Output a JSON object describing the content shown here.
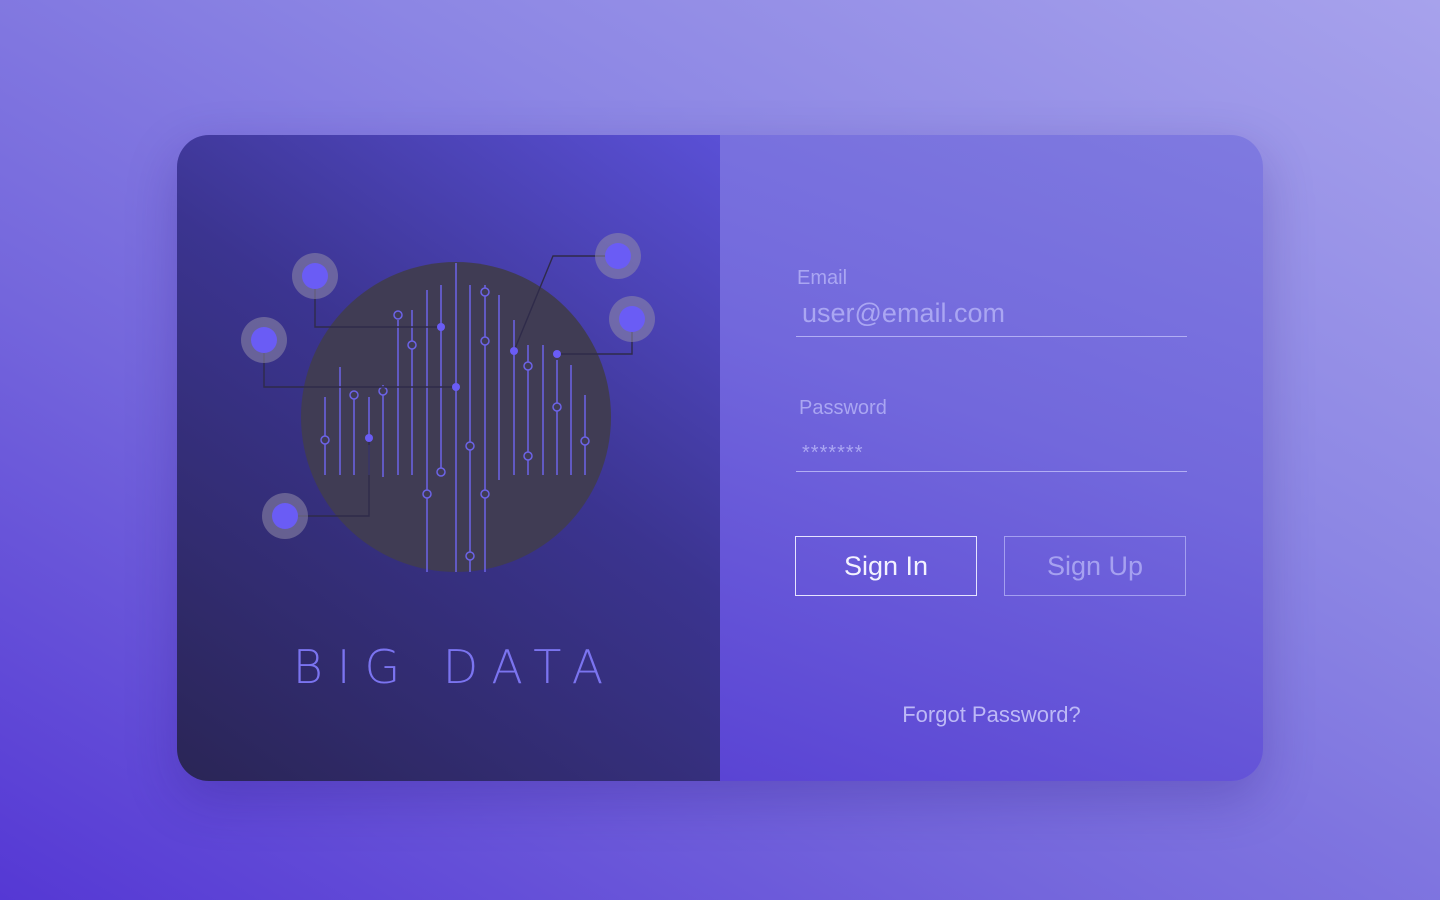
{
  "branding": {
    "title": "BIG DATA",
    "illustration_icon": "circuit-brain-icon"
  },
  "form": {
    "email_label": "Email",
    "email_placeholder": "user@email.com",
    "email_value": "",
    "password_label": "Password",
    "password_value": "*******",
    "signin_label": "Sign In",
    "signup_label": "Sign Up",
    "forgot_label": "Forgot Password?"
  },
  "colors": {
    "accent": "#6b5cff",
    "circle": "#3f3c53",
    "left_panel_dark": "#2a2556",
    "right_panel": "#7268dc"
  }
}
